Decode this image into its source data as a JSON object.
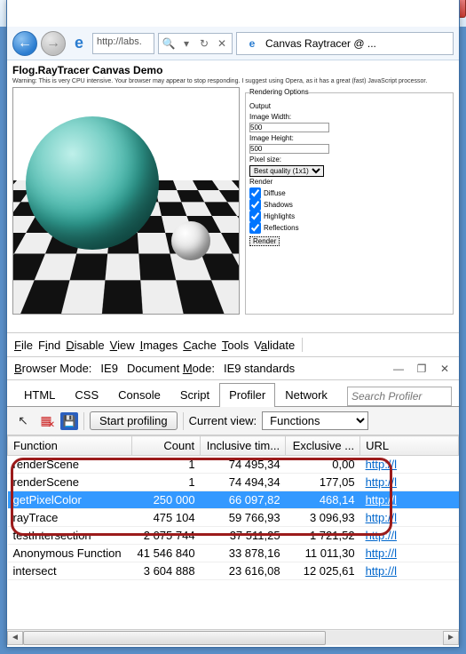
{
  "window": {
    "min": "—",
    "max": "□",
    "close": "✕"
  },
  "nav": {
    "address": "http://labs.",
    "tab_title": "Canvas Raytracer @ ..."
  },
  "page": {
    "title": "Flog.RayTracer Canvas Demo",
    "warning": "Warning: This is very CPU intensive. Your browser may appear to stop responding. I suggest using Opera, as it has a great (fast) JavaScript processor.",
    "options": {
      "legend": "Rendering Options",
      "output": "Output",
      "img_w_label": "Image Width:",
      "img_w": "500",
      "img_h_label": "Image Height:",
      "img_h": "500",
      "px_label": "Pixel size:",
      "px_value": "Best quality (1x1)",
      "render_section": "Render",
      "diffuse": "Diffuse",
      "shadows": "Shadows",
      "highlights": "Highlights",
      "reflections": "Reflections",
      "render_btn": "Render"
    }
  },
  "menu": {
    "file": "File",
    "find": "Find",
    "disable": "Disable",
    "view": "View",
    "images": "Images",
    "cache": "Cache",
    "tools": "Tools",
    "validate": "Validate"
  },
  "mode": {
    "browser_label": "Browser Mode:",
    "browser_value": "IE9",
    "doc_label": "Document Mode:",
    "doc_value": "IE9 standards"
  },
  "tabs": {
    "html": "HTML",
    "css": "CSS",
    "console": "Console",
    "script": "Script",
    "profiler": "Profiler",
    "network": "Network",
    "search_placeholder": "Search Profiler"
  },
  "toolbar": {
    "start": "Start profiling",
    "view_label": "Current view:",
    "view_value": "Functions"
  },
  "columns": {
    "fn": "Function",
    "count": "Count",
    "incl": "Inclusive tim...",
    "excl": "Exclusive ...",
    "url": "URL"
  },
  "rows": [
    {
      "fn": "renderScene",
      "count": "1",
      "incl": "74 495,34",
      "excl": "0,00",
      "url": "http://l",
      "sel": false,
      "grp": true
    },
    {
      "fn": "renderScene",
      "count": "1",
      "incl": "74 494,34",
      "excl": "177,05",
      "url": "http://l",
      "sel": false,
      "grp": true
    },
    {
      "fn": "getPixelColor",
      "count": "250 000",
      "incl": "66 097,82",
      "excl": "468,14",
      "url": "http://l",
      "sel": true,
      "grp": true
    },
    {
      "fn": "rayTrace",
      "count": "475 104",
      "incl": "59 766,93",
      "excl": "3 096,93",
      "url": "http://l",
      "sel": false,
      "grp": true
    },
    {
      "fn": "testIntersection",
      "count": "2 075 744",
      "incl": "37 511,25",
      "excl": "1 721,52",
      "url": "http://l",
      "sel": false,
      "grp": false
    },
    {
      "fn": "Anonymous Function",
      "count": "41 546 840",
      "incl": "33 878,16",
      "excl": "11 011,30",
      "url": "http://l",
      "sel": false,
      "grp": false
    },
    {
      "fn": "intersect",
      "count": "3 604 888",
      "incl": "23 616,08",
      "excl": "12 025,61",
      "url": "http://l",
      "sel": false,
      "grp": false
    }
  ]
}
